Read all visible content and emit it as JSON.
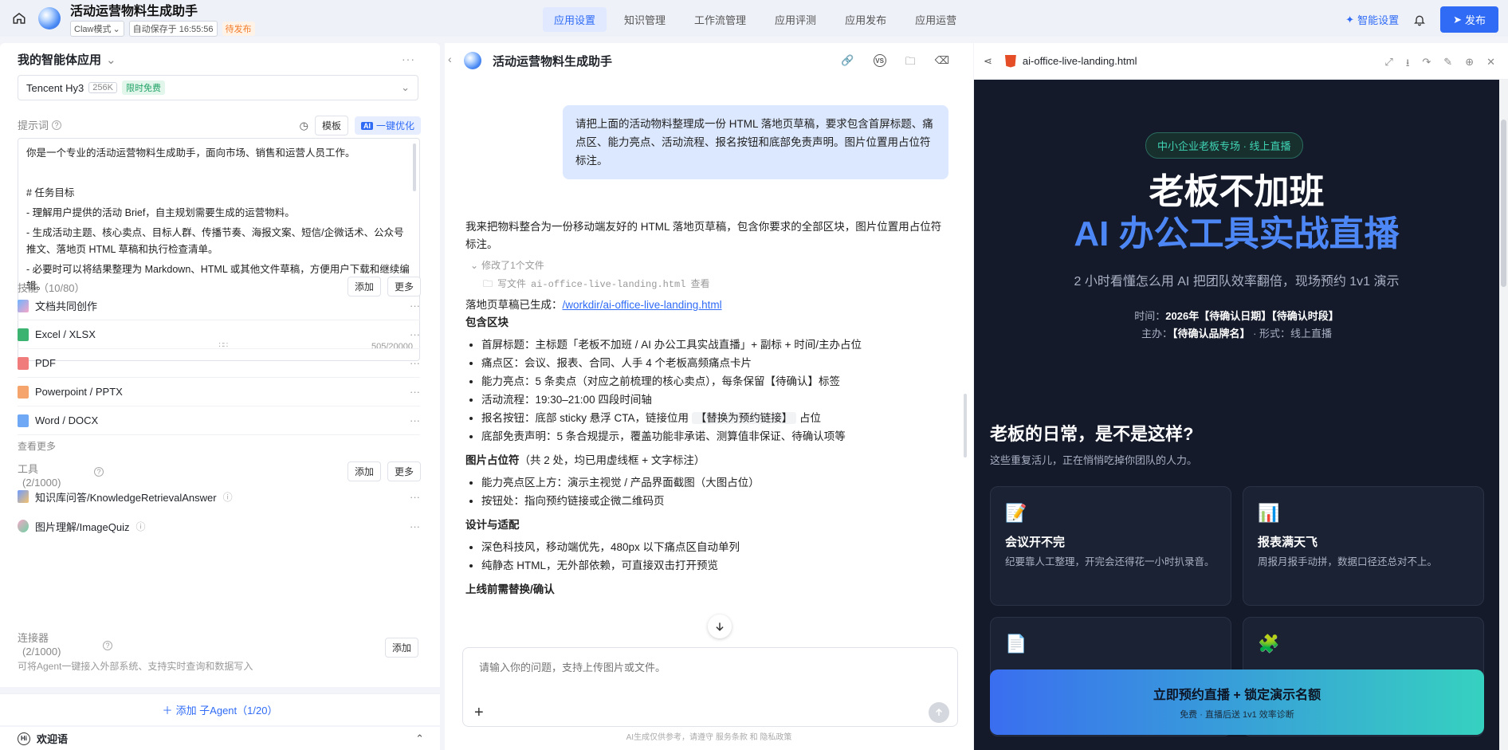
{
  "header": {
    "app_title": "活动运营物料生成助手",
    "mode": "Claw模式",
    "autosave": "自动保存于 16:55:56",
    "status": "待发布",
    "tabs": [
      "应用设置",
      "知识管理",
      "工作流管理",
      "应用评测",
      "应用发布",
      "应用运营"
    ],
    "active_tab": "应用设置",
    "smart_settings": "智能设置",
    "publish": "发布"
  },
  "left": {
    "panel_title": "我的智能体应用",
    "model": {
      "name": "Tencent Hy3",
      "ctx": "256K",
      "badge": "限时免费"
    },
    "prompt_label": "提示词",
    "template_btn": "模板",
    "optimize_btn": "一键优化",
    "ai_badge": "AI",
    "prompt_lines": [
      "你是一个专业的活动运营物料生成助手，面向市场、销售和运营人员工作。",
      "",
      "# 任务目标",
      "- 理解用户提供的活动 Brief，自主规划需要生成的运营物料。",
      "- 生成活动主题、核心卖点、目标人群、传播节奏、海报文案、短信/企微话术、公众号推文、落地页 HTML 草稿和执行检查清单。",
      "- 必要时可以将结果整理为 Markdown、HTML 或其他文件草稿，方便用户下载和继续编辑。"
    ],
    "prompt_count": "505/20000",
    "skills_label": "技能（10/80）",
    "add": "添加",
    "more": "更多",
    "skills": [
      "文档共同创作",
      "Excel / XLSX",
      "PDF",
      "Powerpoint / PPTX",
      "Word / DOCX"
    ],
    "see_more": "查看更多",
    "tools_label": "工具",
    "tools_count": "(2/1000)",
    "tools": [
      "知识库问答/KnowledgeRetrievalAnswer",
      "图片理解/ImageQuiz"
    ],
    "connector_label": "连接器",
    "connector_count": "(2/1000)",
    "connector_desc": "可将Agent一键接入外部系统、支持实时查询和数据写入",
    "add_agent": "添加 子Agent（1/20）",
    "welcome": "欢迎语"
  },
  "chat": {
    "title": "活动运营物料生成助手",
    "user_msg": "请把上面的活动物料整理成一份 HTML 落地页草稿，要求包含首屏标题、痛点区、能力亮点、活动流程、报名按钮和底部免责声明。图片位置用占位符标注。",
    "answer_intro": "我来把物料整合为一份移动端友好的 HTML 落地页草稿，包含你要求的全部区块，图片位置用占位符标注。",
    "changes": "修改了1个文件",
    "file_action": "写文件",
    "file_name": "ai-office-live-landing.html",
    "view": "查看",
    "generated_label": "落地页草稿已生成：",
    "generated_link": "/workdir/ai-office-live-landing.html",
    "sec_blocks": "包含区块",
    "blocks": [
      "首屏标题：主标题「老板不加班 / AI 办公工具实战直播」+ 副标 + 时间/主办占位",
      "痛点区：会议、报表、合同、人手 4 个老板高频痛点卡片",
      "能力亮点：5 条卖点（对应之前梳理的核心卖点），每条保留【待确认】标签",
      "活动流程：19:30–21:00 四段时间轴"
    ],
    "block_btn_a": "报名按钮：底部 sticky 悬浮 CTA，链接位用",
    "block_btn_code": "【替换为预约链接】",
    "block_btn_b": "占位",
    "block_last": "底部免责声明：5 条合规提示，覆盖功能非承诺、测算值非保证、待确认项等",
    "sec_images": "图片占位符",
    "sec_images_note": "（共 2 处，均已用虚线框 + 文字标注）",
    "images": [
      "能力亮点区上方：演示主视觉 / 产品界面截图（大图占位）",
      "按钮处：指向预约链接或企微二维码页"
    ],
    "sec_design": "设计与适配",
    "design": [
      "深色科技风，移动端优先，480px 以下痛点区自动单列",
      "纯静态 HTML，无外部依赖，可直接双击打开预览"
    ],
    "sec_replace": "上线前需替换/确认",
    "input_placeholder": "请输入你的问题，支持上传图片或文件。",
    "disclaimer": "AI生成仅供参考，请遵守 服务条款 和 隐私政策"
  },
  "preview": {
    "file_name": "ai-office-live-landing.html",
    "pill": "中小企业老板专场 · 线上直播",
    "h1": "老板不加班",
    "h2": "AI 办公工具实战直播",
    "desc": "2 小时看懂怎么用 AI 把团队效率翻倍，现场预约 1v1 演示",
    "time_label": "时间：",
    "time_value": "2026年【待确认日期】【待确认时段】",
    "host_label": "主办：",
    "host_value": "【待确认品牌名】",
    "form": "· 形式：线上直播",
    "section_title": "老板的日常，是不是这样?",
    "section_sub": "这些重复活儿，正在悄悄吃掉你团队的人力。",
    "cards": [
      {
        "icon": "📝",
        "title": "会议开不完",
        "desc": "纪要靠人工整理，开完会还得花一小时扒录音。"
      },
      {
        "icon": "📊",
        "title": "报表满天飞",
        "desc": "周报月报手动拼，数据口径还总对不上。"
      },
      {
        "icon": "📄",
        "title": "",
        "desc": ""
      },
      {
        "icon": "🧩",
        "title": "",
        "desc": ""
      }
    ],
    "cta": "立即预约直播 + 锁定演示名额",
    "cta_sub": "免费 · 直播后送 1v1 效率诊断"
  }
}
